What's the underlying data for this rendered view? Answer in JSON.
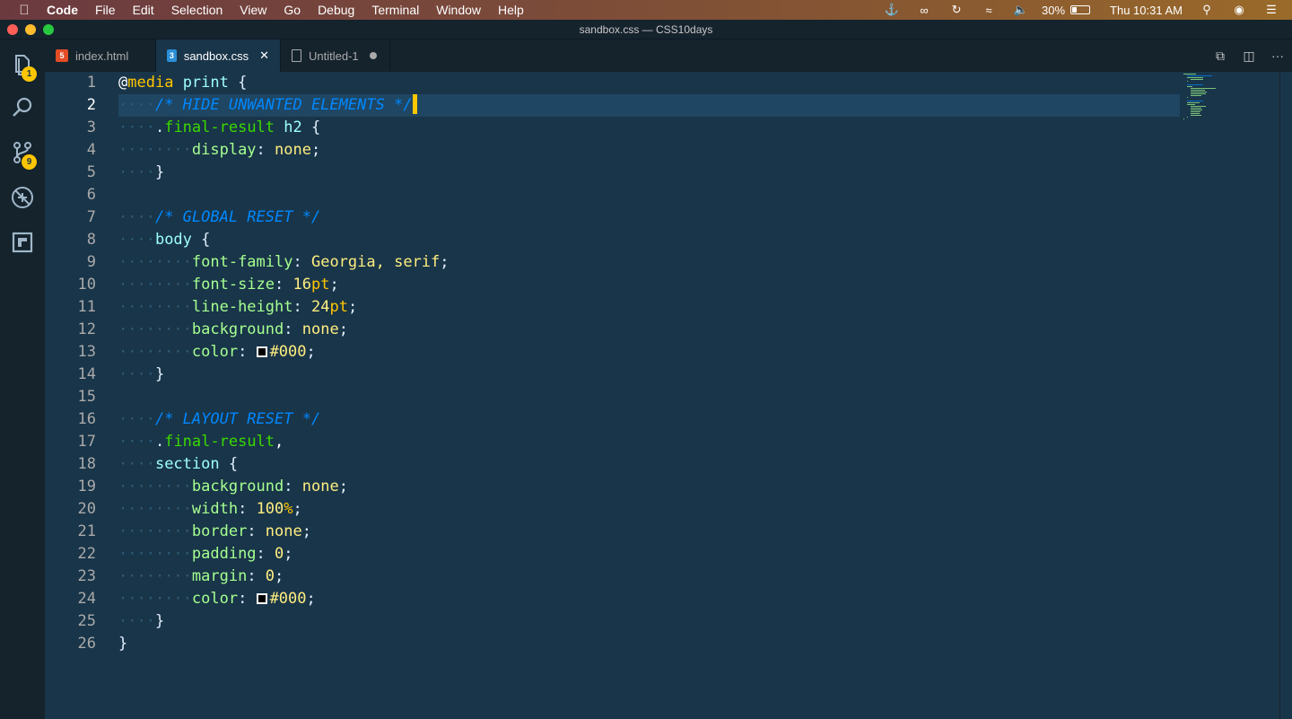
{
  "menubar": {
    "app_name": "Code",
    "items": [
      "File",
      "Edit",
      "Selection",
      "View",
      "Go",
      "Debug",
      "Terminal",
      "Window",
      "Help"
    ],
    "battery": "30%",
    "battery_level": 0.3,
    "clock": "Thu 10:31 AM"
  },
  "window": {
    "title": "sandbox.css — CSS10days"
  },
  "activity": {
    "explorer_badge": "1",
    "scm_badge": "9"
  },
  "tabs": [
    {
      "label": "index.html",
      "icon": "html5-icon",
      "active": false
    },
    {
      "label": "sandbox.css",
      "icon": "css3-icon",
      "active": true
    },
    {
      "label": "Untitled-1",
      "icon": "file-icon",
      "active": false,
      "dirty": true
    }
  ],
  "editor": {
    "line_numbers": [
      "1",
      "2",
      "3",
      "4",
      "5",
      "6",
      "7",
      "8",
      "9",
      "10",
      "11",
      "12",
      "13",
      "14",
      "15",
      "16",
      "17",
      "18",
      "19",
      "20",
      "21",
      "22",
      "23",
      "24",
      "25",
      "26"
    ],
    "active_line": 2,
    "lines": [
      "@media print {",
      "  /* HIDE UNWANTED ELEMENTS */",
      "  .final-result h2 {",
      "    display: none;",
      "  }",
      "",
      "  /* GLOBAL RESET */",
      "  body {",
      "    font-family: Georgia, serif;",
      "    font-size: 16pt;",
      "    line-height: 24pt;",
      "    background: none;",
      "    color: #000;",
      "  }",
      "",
      "  /* LAYOUT RESET */",
      "  .final-result,",
      "  section {",
      "    background: none;",
      "    width: 100%;",
      "    border: none;",
      "    padding: 0;",
      "    margin: 0;",
      "    color: #000;",
      "  }",
      "}"
    ]
  },
  "colors": {
    "background": "#193549",
    "keyword": "#ffc600",
    "comment": "#0088ff",
    "class": "#3ad900",
    "property": "#a5ff90",
    "value": "#ffee80"
  }
}
